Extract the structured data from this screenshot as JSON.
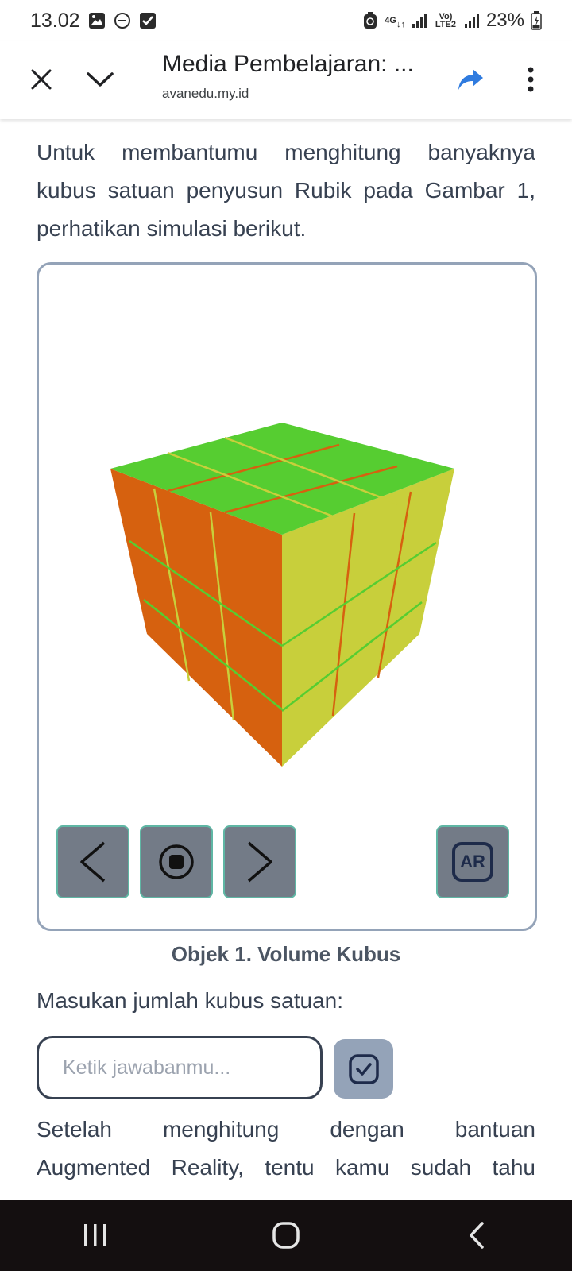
{
  "status_bar": {
    "time": "13.02",
    "network": "4G",
    "lte": "Vo) LTE2",
    "battery": "23%"
  },
  "browser": {
    "title": "Media Pembelajaran: ...",
    "url": "avanedu.my.id",
    "icons": [
      "close-icon",
      "chevron-down-icon",
      "share-icon",
      "more-vert-icon"
    ]
  },
  "content": {
    "intro": "Untuk membantumu menghitung banyaknya kubus satuan penyusun Rubik pada Gambar 1, perhatikan simulasi berikut.",
    "viewer": {
      "buttons": [
        "prev-icon",
        "stop-icon",
        "next-icon"
      ],
      "ar_label": "AR"
    },
    "caption": "Objek 1. Volume Kubus",
    "prompt_label": "Masukan jumlah kubus satuan:",
    "answer": {
      "placeholder": "Ketik jawabanmu...",
      "value": ""
    },
    "followup_line1": "Setelah menghitung dengan bantuan",
    "followup_line2": "Augmented Reality, tentu kamu sudah tahu"
  },
  "colors": {
    "cube_top": "#56cd31",
    "cube_left": "#d6610f",
    "cube_right": "#c8cf3b",
    "viewer_border": "#94a3b8",
    "control_button": "#737b87",
    "nav_bar": "#140f10",
    "share_icon": "#2f7bdf"
  }
}
